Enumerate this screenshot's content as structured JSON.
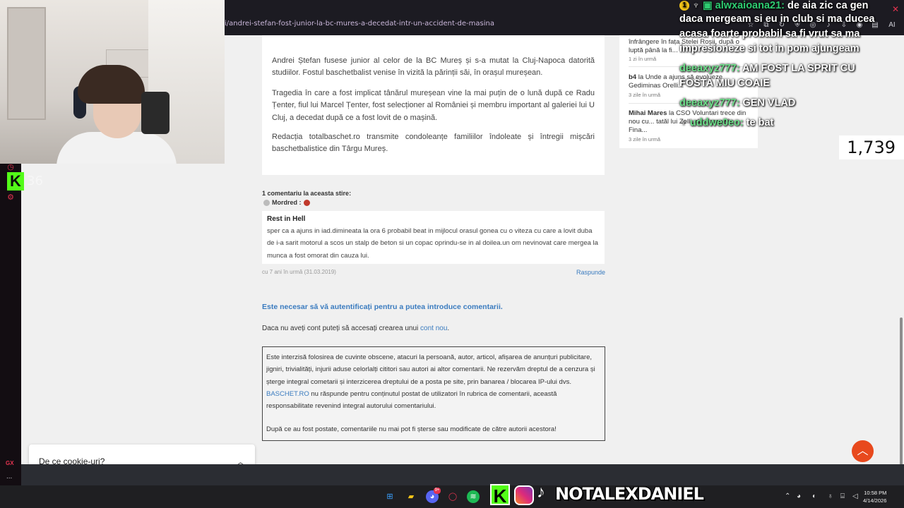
{
  "browser": {
    "url": "i/andrei-stefan-fost-junior-la-bc-mures-a-decedat-intr-un-accident-de-masina",
    "toolbar_icon_names": [
      "bookmark-icon",
      "extensions-icon",
      "reload-icon",
      "shield-icon",
      "vpn-icon",
      "notifications-icon",
      "download-icon",
      "profile-icon",
      "sidebar-icon",
      "ai-icon"
    ],
    "ai_label": "AI"
  },
  "article": {
    "paragraphs": [
      "Andrei Ștefan fusese junior al celor de la BC Mureș și s-a mutat la Cluj-Napoca datorită studiilor. Fostul baschetbalist venise în vizită la părinții săi, în orașul mureșean.",
      "Tragedia în care a fost implicat tânărul mureșean vine la mai puțin de o lună după ce Radu Țenter, fiul lui Marcel Țenter, fost selecționer al României și membru important al galeriei lui U Cluj, a decedat după ce a fost lovit de o mașină.",
      "Redacția totalbaschet.ro transmite condoleanțe familiilor îndoleate și întregii mișcări baschetbalistice din Târgu Mureș."
    ]
  },
  "comments": {
    "count_label": "1 comentariu la aceasta stire:",
    "author": "Mordred :",
    "title": "Rest in Hell",
    "text": "sper ca a ajuns in iad.dimineata la ora 6 probabil beat in mijlocul orasul gonea cu o viteza cu care a lovit duba de i-a sarit motorul a scos un stalp de beton si un copac oprindu-se in al doilea.un om nevinovat care mergea la munca a fost omorat din cauza lui.",
    "time": "cu 7 ani în urmă (31.03.2019)",
    "reply_label": "Raspunde"
  },
  "auth": {
    "message": "Este necesar să vă autentificați pentru a putea introduce comentarii.",
    "account_text": "Daca nu aveți cont puteți să accesați crearea unui ",
    "account_link": "cont nou",
    "account_end": "."
  },
  "rules": {
    "text1": "Este interzisă folosirea de cuvinte obscene, atacuri la persoană, autor, articol, afișarea de anunțuri publicitare, jigniri, trivialități, injurii aduse celorlalți cititori sau autori ai altor comentarii. Ne rezervăm dreptul de a cenzura și șterge integral cometarii și interzicerea dreptului de a posta pe site, prin banarea / blocarea IP-ului dvs.",
    "brand": "BASCHET.RO",
    "text2": " nu răspunde pentru conținutul postat de utilizatori în rubrica de comentarii, această responsabilitate revenind integral autorului comentariului.",
    "text3": "După ce au fost postate, comentariile nu mai pot fi șterse sau modificate de către autorii acestora!"
  },
  "sidebar": {
    "items": [
      {
        "name": "",
        "text": "înfrângere în fața Stelei Roșii, după o luptă până la fi...",
        "time": "1 zi în urmă"
      },
      {
        "name": "b4",
        "text": " la Unde a ajuns să evolueze Gediminas Orelli...",
        "time": "3 zile în urmă"
      },
      {
        "name": "Mihai Mares",
        "text": " la CSO Voluntari trece din nou cu... tatăl lui Zelli, dar merge în Fina...",
        "time": "3 zile în urmă"
      }
    ]
  },
  "chat": {
    "line1_user": "alwxaioana21:",
    "line1_text": " de aia zic ca gen",
    "line2": "daca mergeam si eu in club si ma ducea",
    "line3": "acasa foarte probabil sa fi vrut sa ma",
    "line4": "impresioneze si tot in pom ajungeam",
    "line5_user": "deeaxyz777:",
    "line5_text": " AM FOST LA SPRIT CU",
    "line6": "FOSTA MIU COAIE",
    "line7_user": "deeaxyz777:",
    "line7_text": " GEN VLAD",
    "line8_user": "uddwe0eo:",
    "line8_text": " te bat",
    "badge": "1"
  },
  "stream": {
    "viewers": "1,739",
    "kick_count": "36",
    "kick_letter": "K",
    "brand_name": "NOTALEXDANIEL"
  },
  "cookie": {
    "label": "De ce cookie-uri?"
  },
  "rail": {
    "gx_label": "GX",
    "more": "..."
  },
  "taskbar": {
    "time": "10:58 PM",
    "date": "4/14/2026",
    "discord_badge": "9+"
  },
  "colors": {
    "accent": "#3a7bbf",
    "kick": "#53fc18",
    "opera_red": "#e3334f",
    "scroll_top": "#e8491d"
  }
}
